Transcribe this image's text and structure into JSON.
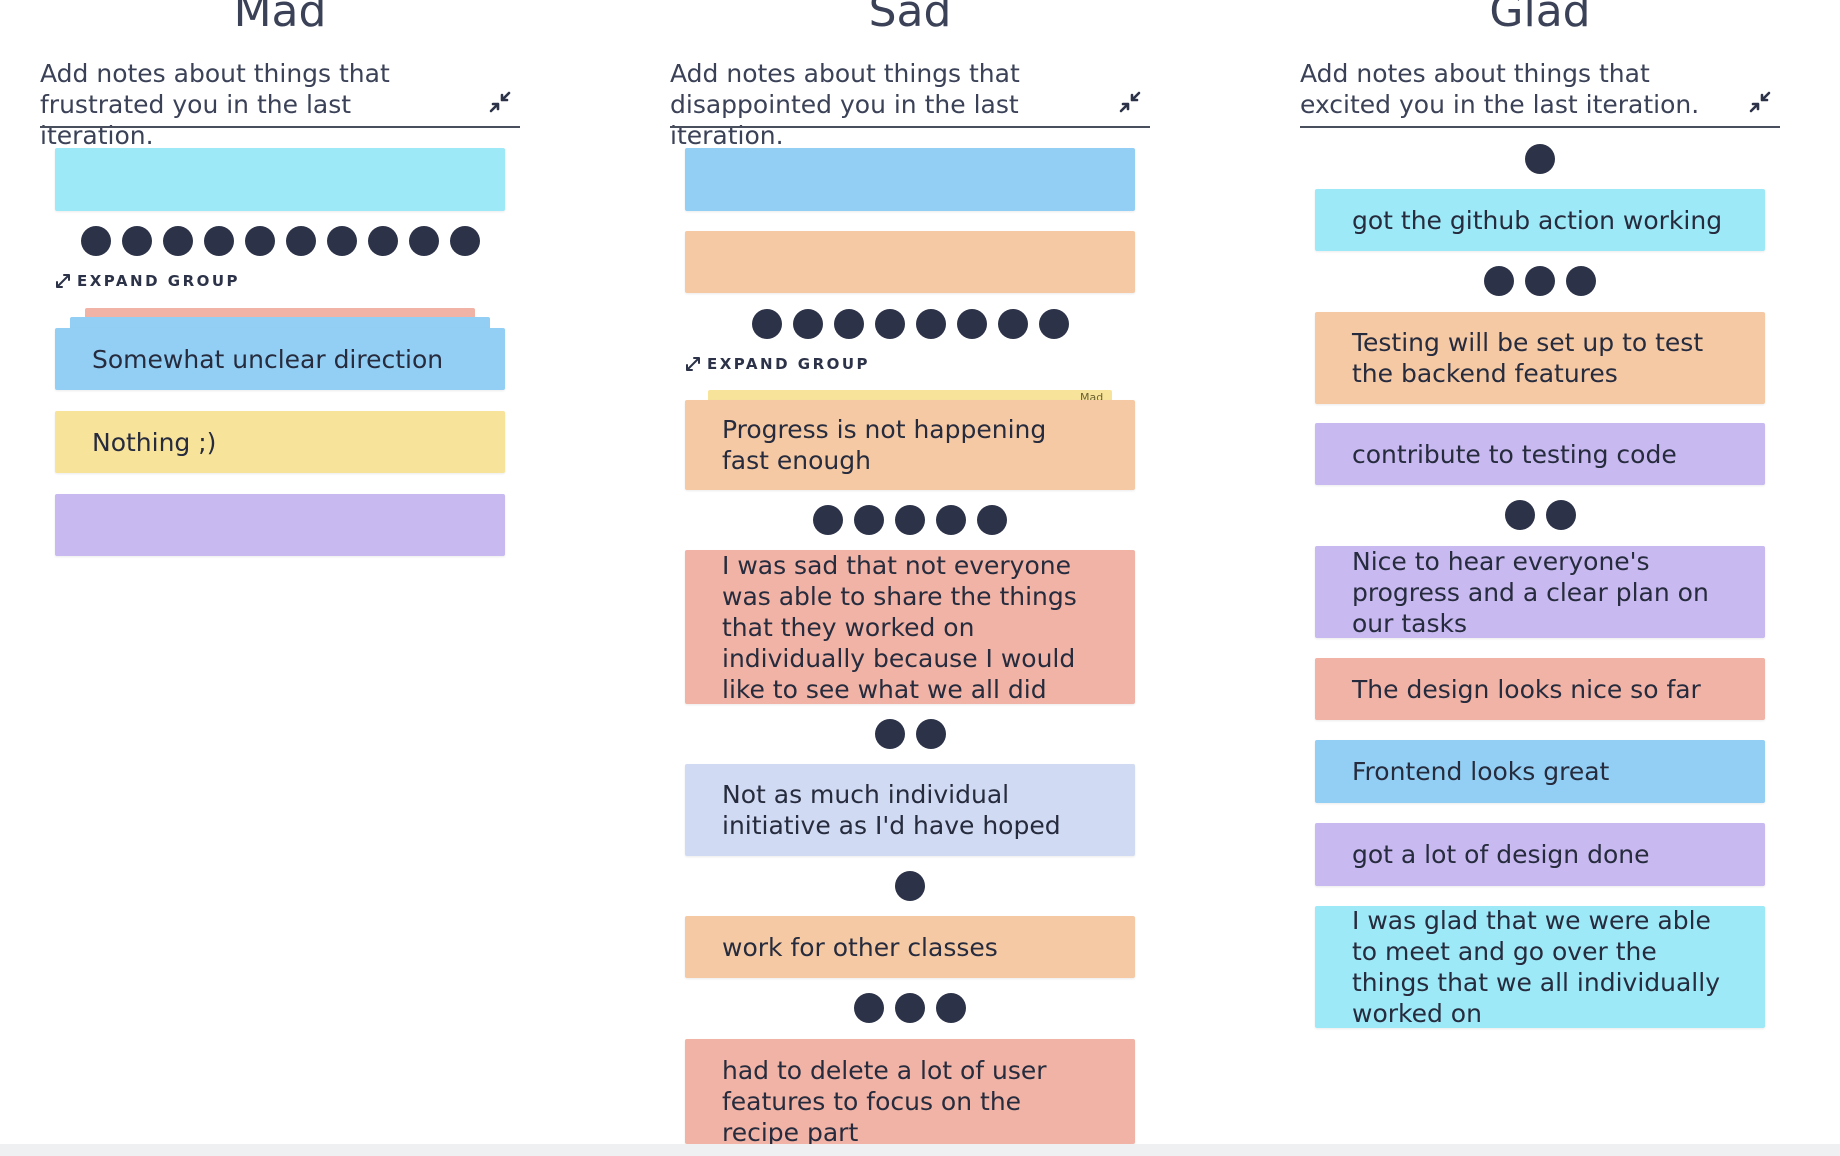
{
  "colors": {
    "cyan": "#9de9f7",
    "blue": "#93cff4",
    "peach": "#f5c9a4",
    "salmon": "#f0b3a5",
    "yellow": "#f8e39b",
    "lavender": "#c8b9f0",
    "periwinkle": "#d0daf2",
    "dot": "#2c3248"
  },
  "icons": {
    "collapse": "collapse-arrows-icon",
    "expand": "expand-arrows-icon"
  },
  "columns": {
    "mad": {
      "title": "Mad",
      "description": "Add notes about things that frustrated you in the last iteration.",
      "expand_label": "EXPAND GROUP",
      "group_votes": 10,
      "cards": {
        "empty_top": "",
        "unclear": "Somewhat unclear direction",
        "nothing": "Nothing ;)",
        "empty_bottom": ""
      }
    },
    "sad": {
      "title": "Sad",
      "description": "Add notes about things that disappointed you in the last iteration.",
      "expand_label": "EXPAND GROUP",
      "stack_tag": "Mad",
      "group_votes": 8,
      "cards": {
        "empty_blue": "",
        "empty_peach": "",
        "progress": "Progress is not happening fast enough",
        "share": "I was sad that not everyone was able to share the things that they worked on individually because I would like to see what we all did",
        "initiative": "Not as much individual initiative as I'd have hoped",
        "classes": "work for other classes",
        "delete": "had to delete a lot of user features to focus on the recipe part"
      },
      "votes": {
        "progress": 5,
        "share": 2,
        "initiative": 1,
        "classes": 3
      }
    },
    "glad": {
      "title": "Glad",
      "description": "Add notes about things that excited you in the last iteration.",
      "cards": {
        "github": "got the github action working",
        "testing_setup": "Testing will be set up to test the backend features",
        "testing_code": "contribute to testing code",
        "progress_plan": "Nice to hear everyone's progress and a clear plan on our tasks",
        "design_nice": "The design looks nice so far",
        "frontend": "Frontend looks great",
        "design_done": "got a lot of design done",
        "meet": "I was glad that we were able to meet and go over the things that we all individually worked on"
      },
      "votes": {
        "top": 1,
        "github": 3,
        "testing_code": 2
      }
    }
  }
}
